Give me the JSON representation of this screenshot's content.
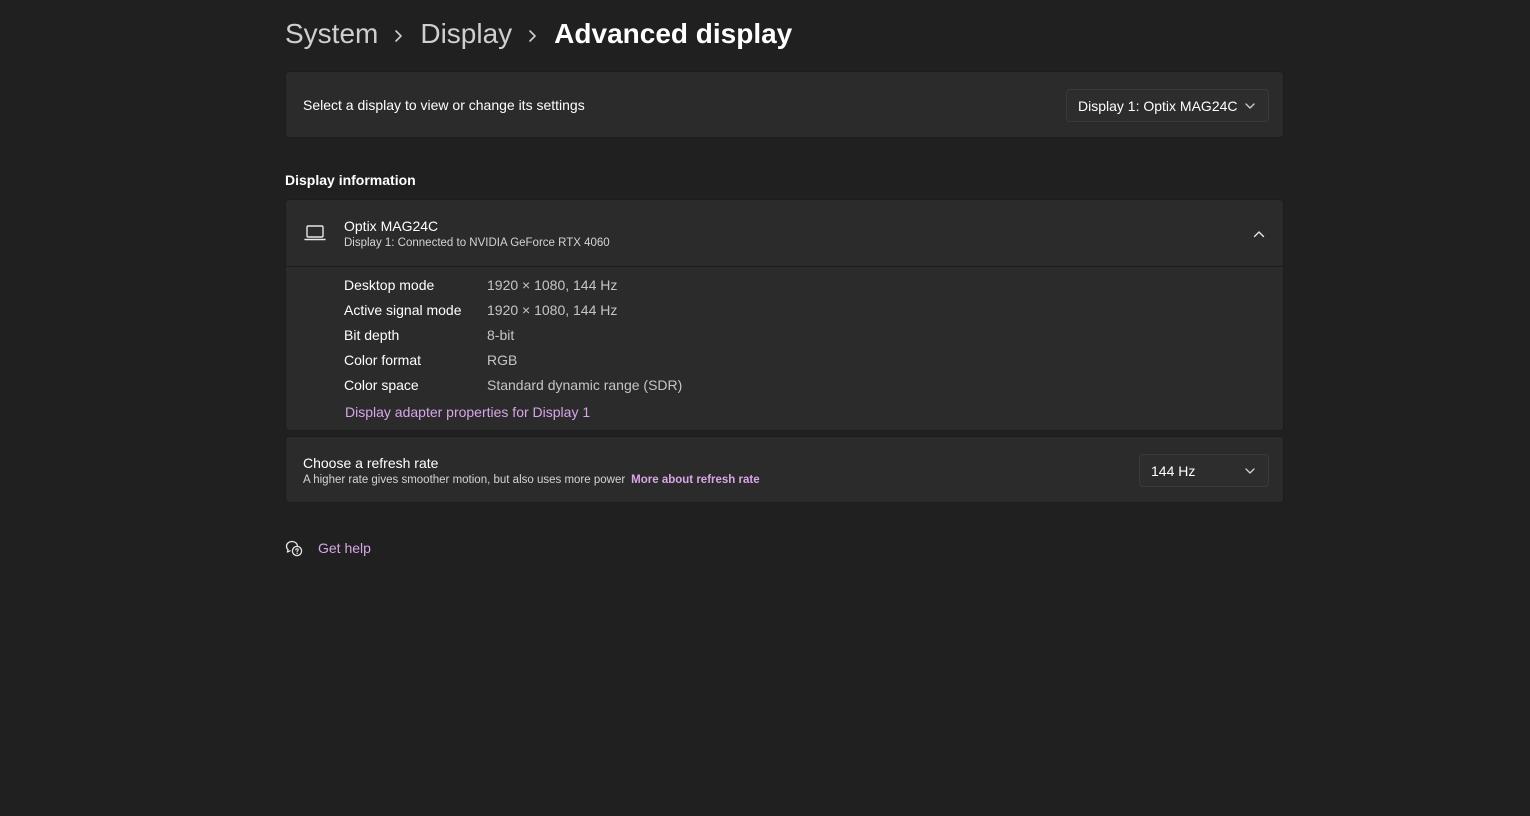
{
  "breadcrumb": {
    "items": [
      "System",
      "Display"
    ],
    "current": "Advanced display"
  },
  "select_display": {
    "label": "Select a display to view or change its settings",
    "selected": "Display 1: Optix MAG24C"
  },
  "display_information": {
    "section_title": "Display information",
    "name": "Optix MAG24C",
    "subtitle": "Display 1: Connected to NVIDIA GeForce RTX 4060",
    "rows": [
      {
        "key": "Desktop mode",
        "value": "1920 × 1080, 144 Hz"
      },
      {
        "key": "Active signal mode",
        "value": "1920 × 1080, 144 Hz"
      },
      {
        "key": "Bit depth",
        "value": "8-bit"
      },
      {
        "key": "Color format",
        "value": "RGB"
      },
      {
        "key": "Color space",
        "value": "Standard dynamic range (SDR)"
      }
    ],
    "adapter_link": "Display adapter properties for Display 1"
  },
  "refresh_rate": {
    "title": "Choose a refresh rate",
    "description": "A higher rate gives smoother motion, but also uses more power",
    "link": "More about refresh rate",
    "selected": "144 Hz"
  },
  "help": {
    "label": "Get help"
  },
  "colors": {
    "background": "#202020",
    "card": "#2b2b2b",
    "accent_link": "#d9a5e8"
  },
  "icons": {
    "breadcrumb_separator": "chevron-right-icon",
    "dropdown": "chevron-down-icon",
    "display_device": "laptop-icon",
    "collapse": "chevron-up-icon",
    "help": "help-chat-icon"
  }
}
